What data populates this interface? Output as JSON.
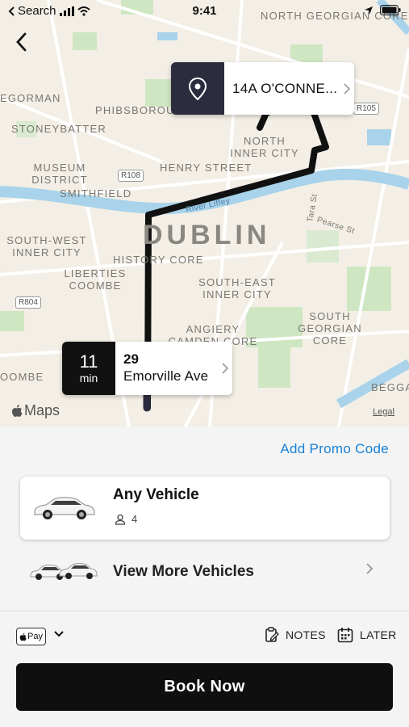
{
  "status_bar": {
    "back_app": "Search",
    "time": "9:41"
  },
  "map": {
    "city_label": "Dublin",
    "district_labels": [
      "NORTH GEORGIAN CORE",
      "EGORMAN",
      "PHIBSBOROUGH",
      "STONEYBATTER",
      "NORTH INNER CITY",
      "MUSEUM DISTRICT",
      "HENRY STREET",
      "SMITHFIELD",
      "SOUTH-WEST INNER CITY",
      "HISTORY CORE",
      "LIBERTIES COOMBE",
      "SOUTH-EAST INNER CITY",
      "SOUTH GEORGIAN CORE",
      "ANGIERY CAMDEN CORE",
      "OOMBE",
      "BEGGA"
    ],
    "street_labels": [
      "River Liffey",
      "Pearse St",
      "Tara St"
    ],
    "road_shields": [
      "R105",
      "R108",
      "R804"
    ],
    "attribution": "Maps",
    "legal": "Legal",
    "colors": {
      "route": "#111111",
      "river": "#a9d3ea",
      "park": "#cfe6c2"
    }
  },
  "destination": {
    "address": "14A O'CONNE...",
    "icon": "location-pin-icon"
  },
  "origin": {
    "eta_value": "11",
    "eta_unit": "min",
    "street_number": "29",
    "street_name": "Emorville Ave"
  },
  "sheet": {
    "promo_label": "Add Promo Code",
    "vehicle": {
      "name": "Any Vehicle",
      "seats": "4"
    },
    "more_vehicles_label": "View More Vehicles",
    "payment": {
      "method": "Pay",
      "icon": "apple-pay-icon"
    },
    "notes_label": "NOTES",
    "later_label": "LATER",
    "book_label": "Book Now"
  }
}
